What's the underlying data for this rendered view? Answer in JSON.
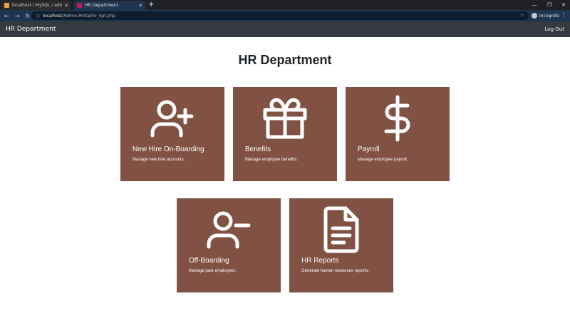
{
  "browser": {
    "tabs": [
      {
        "title": "localhost / MySQL / admin / usu",
        "active": false
      },
      {
        "title": "HR Department",
        "active": true
      }
    ],
    "url_host": "localhost",
    "url_path": "/Admin-Portal/hr_dpt.php",
    "incognito_label": "Incognito"
  },
  "navbar": {
    "brand": "HR Department",
    "logout": "Log Out"
  },
  "page": {
    "title": "HR Department"
  },
  "cards": [
    {
      "id": "new-hire",
      "title": "New Hire On-Boarding",
      "description": "Manage new hire accounts.",
      "icon": "user-plus-icon"
    },
    {
      "id": "benefits",
      "title": "Benefits",
      "description": "Manage employee benefits.",
      "icon": "gift-icon"
    },
    {
      "id": "payroll",
      "title": "Payroll",
      "description": "Manage employee payroll.",
      "icon": "dollar-icon"
    },
    {
      "id": "off-boarding",
      "title": "Off-Boarding",
      "description": "Manage past employees.",
      "icon": "user-minus-icon"
    },
    {
      "id": "hr-reports",
      "title": "HR Reports",
      "description": "Generate human resources reports.",
      "icon": "file-text-icon"
    }
  ],
  "colors": {
    "card": "#815143",
    "navbar": "#343a40",
    "browser_active": "#1f3550"
  }
}
